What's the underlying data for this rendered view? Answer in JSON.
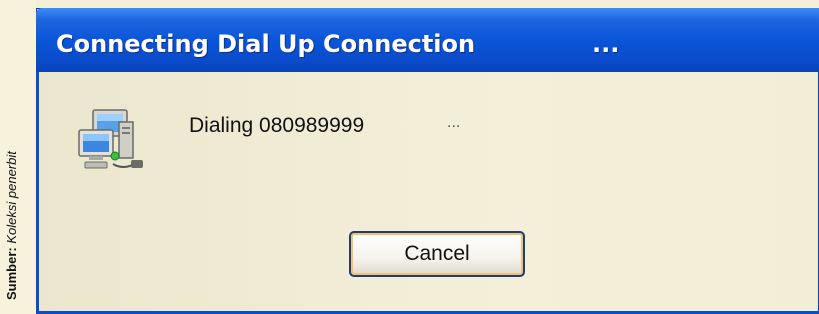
{
  "caption": {
    "source_label": "Sumber:",
    "source_value": "Koleksi penerbit"
  },
  "dialog": {
    "title": "Connecting Dial Up Connection",
    "title_ellipsis": "...",
    "status_text": "Dialing 080989999",
    "status_ellipsis": "...",
    "cancel_label": "Cancel",
    "icon": "network-connection-icon"
  },
  "colors": {
    "titlebar": "#0a55d8",
    "client_bg": "#ece9d8",
    "button_focus": "#f7c06a"
  }
}
